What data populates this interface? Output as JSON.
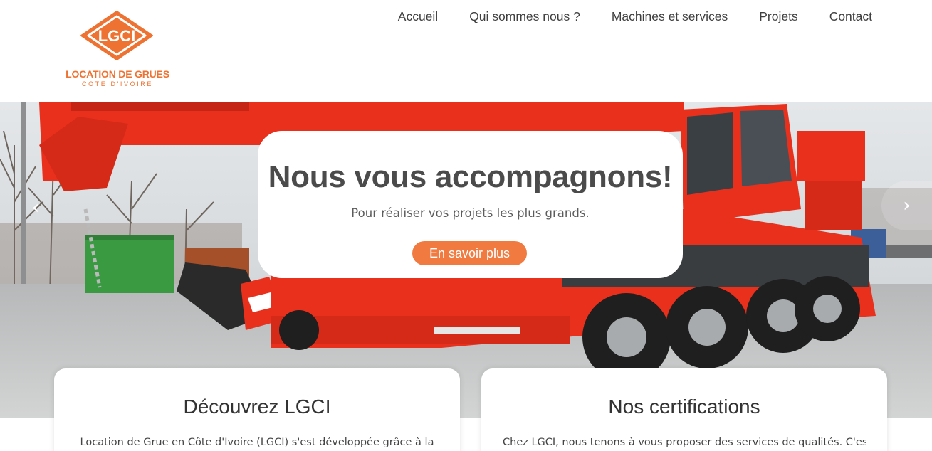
{
  "logo": {
    "mark_text": "LGCI",
    "line1": "LOCATION DE GRUES",
    "line2": "COTE D'IVOIRE"
  },
  "nav": {
    "items": [
      {
        "label": "Accueil"
      },
      {
        "label": "Qui sommes nous ?"
      },
      {
        "label": "Machines et services"
      },
      {
        "label": "Projets"
      },
      {
        "label": "Contact"
      }
    ]
  },
  "hero": {
    "title": "Nous vous accompagnons!",
    "subtitle": "Pour réaliser vos projets les plus grands.",
    "button_label": "En savoir plus",
    "prev_icon": "chevron-left-icon",
    "next_icon": "chevron-right-icon",
    "prev_glyph": "‹",
    "next_glyph": "›"
  },
  "cards": [
    {
      "title": "Découvrez LGCI",
      "text": "Location de Grue en Côte d'Ivoire (LGCI) s'est développée grâce à la"
    },
    {
      "title": "Nos certifications",
      "text": "Chez LGCI, nous tenons à vous proposer des services de qualités. C'est"
    }
  ],
  "colors": {
    "brand_orange": "#ee7231",
    "button_orange": "#f07a3f",
    "crane_red": "#e8301c",
    "nav_text": "#3f3f3f"
  }
}
